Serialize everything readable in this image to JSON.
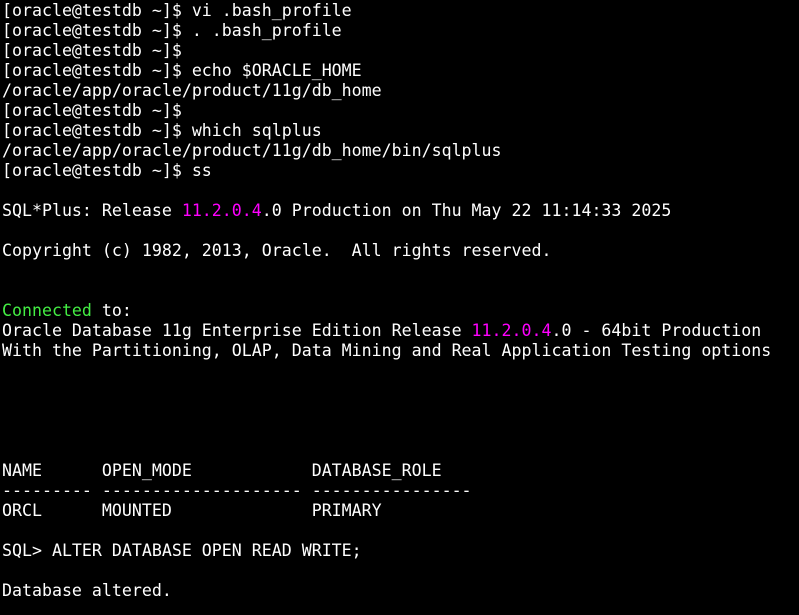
{
  "terminal": {
    "colors": {
      "background": "#000000",
      "foreground": "#ffffff",
      "highlight": "#ff00ff",
      "success": "#44ee44"
    },
    "lines": [
      {
        "segments": [
          {
            "text": "[oracle@testdb ~]$ vi .bash_profile"
          }
        ]
      },
      {
        "segments": [
          {
            "text": "[oracle@testdb ~]$ . .bash_profile"
          }
        ]
      },
      {
        "segments": [
          {
            "text": "[oracle@testdb ~]$"
          }
        ]
      },
      {
        "segments": [
          {
            "text": "[oracle@testdb ~]$ echo $ORACLE_HOME"
          }
        ]
      },
      {
        "segments": [
          {
            "text": "/oracle/app/oracle/product/11g/db_home"
          }
        ]
      },
      {
        "segments": [
          {
            "text": "[oracle@testdb ~]$"
          }
        ]
      },
      {
        "segments": [
          {
            "text": "[oracle@testdb ~]$ which sqlplus"
          }
        ]
      },
      {
        "segments": [
          {
            "text": "/oracle/app/oracle/product/11g/db_home/bin/sqlplus"
          }
        ]
      },
      {
        "segments": [
          {
            "text": "[oracle@testdb ~]$ ss"
          }
        ]
      },
      {
        "segments": [
          {
            "text": ""
          }
        ]
      },
      {
        "segments": [
          {
            "text": "SQL*Plus: Release "
          },
          {
            "text": "11.2.0.4",
            "color": "magenta"
          },
          {
            "text": ".0 Production on Thu May 22 11:14:33 2025"
          }
        ]
      },
      {
        "segments": [
          {
            "text": ""
          }
        ]
      },
      {
        "segments": [
          {
            "text": "Copyright (c) 1982, 2013, Oracle.  All rights reserved."
          }
        ]
      },
      {
        "segments": [
          {
            "text": ""
          }
        ]
      },
      {
        "segments": [
          {
            "text": ""
          }
        ]
      },
      {
        "segments": [
          {
            "text": "Connected",
            "color": "green"
          },
          {
            "text": " to:"
          }
        ]
      },
      {
        "segments": [
          {
            "text": "Oracle Database 11g Enterprise Edition Release "
          },
          {
            "text": "11.2.0.4",
            "color": "magenta"
          },
          {
            "text": ".0 - 64bit Production"
          }
        ]
      },
      {
        "segments": [
          {
            "text": "With the Partitioning, OLAP, Data Mining and Real Application Testing options"
          }
        ]
      },
      {
        "segments": [
          {
            "text": ""
          }
        ]
      },
      {
        "segments": [
          {
            "text": ""
          }
        ]
      },
      {
        "segments": [
          {
            "text": ""
          }
        ]
      },
      {
        "segments": [
          {
            "text": ""
          }
        ]
      },
      {
        "segments": [
          {
            "text": ""
          }
        ]
      },
      {
        "segments": [
          {
            "text": "NAME      OPEN_MODE            DATABASE_ROLE"
          }
        ]
      },
      {
        "segments": [
          {
            "text": "--------- -------------------- ----------------"
          }
        ]
      },
      {
        "segments": [
          {
            "text": "ORCL      MOUNTED              PRIMARY"
          }
        ]
      },
      {
        "segments": [
          {
            "text": ""
          }
        ]
      },
      {
        "segments": [
          {
            "text": "SQL> ALTER DATABASE OPEN READ WRITE;"
          }
        ]
      },
      {
        "segments": [
          {
            "text": ""
          }
        ]
      },
      {
        "segments": [
          {
            "text": "Database altered."
          }
        ]
      }
    ]
  }
}
